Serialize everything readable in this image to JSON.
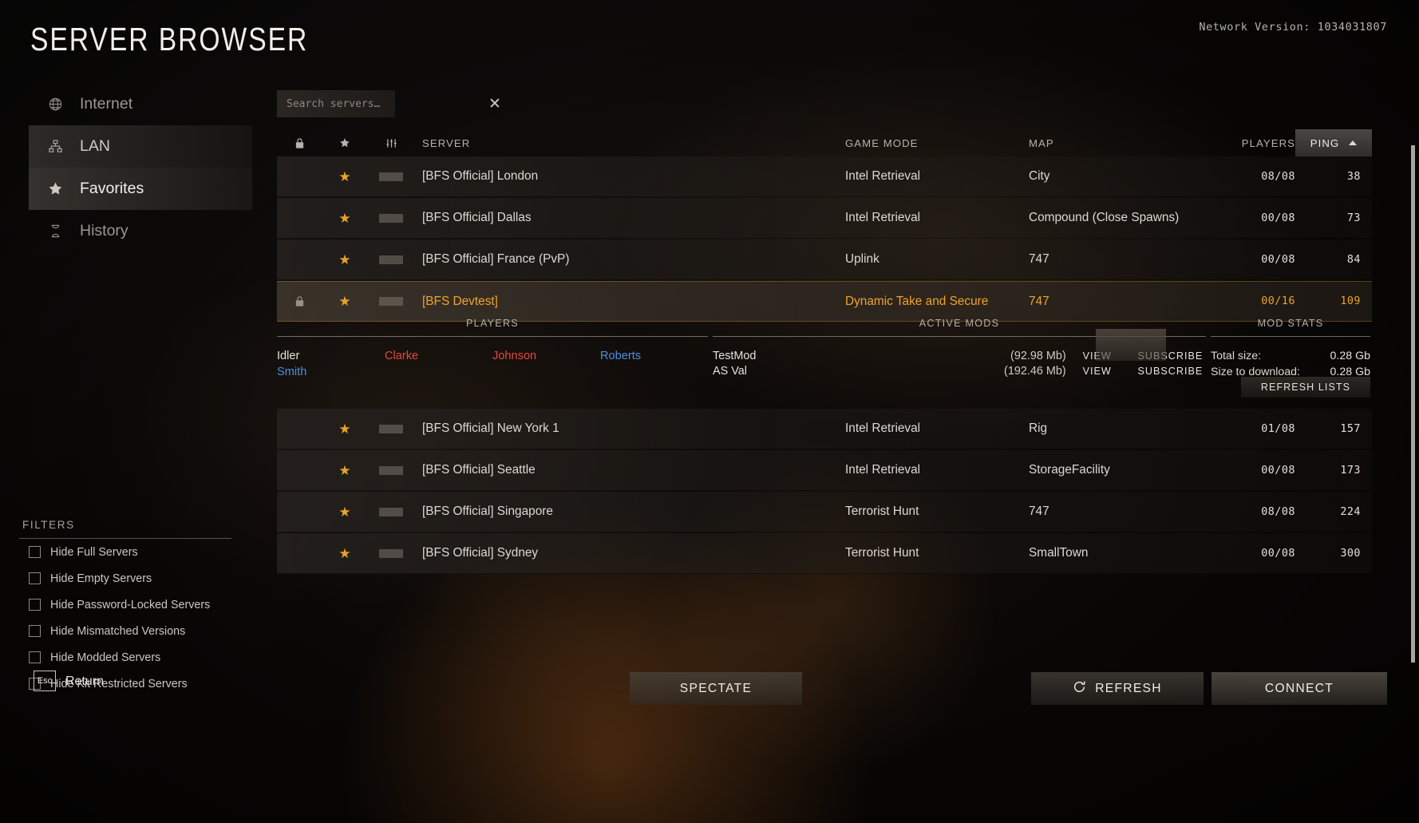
{
  "header": {
    "title": "Server Browser",
    "network_version": "Network Version: 1034031807"
  },
  "sidebar": {
    "items": [
      {
        "label": "Internet",
        "icon": "globe-icon",
        "state": "normal"
      },
      {
        "label": "LAN",
        "icon": "network-icon",
        "state": "hover"
      },
      {
        "label": "Favorites",
        "icon": "star-icon",
        "state": "active"
      },
      {
        "label": "History",
        "icon": "hourglass-icon",
        "state": "normal"
      }
    ]
  },
  "filters": {
    "title": "FILTERS",
    "items": [
      {
        "label": "Hide Full Servers",
        "checked": false
      },
      {
        "label": "Hide Empty Servers",
        "checked": false
      },
      {
        "label": "Hide Password-Locked Servers",
        "checked": false
      },
      {
        "label": "Hide Mismatched Versions",
        "checked": false
      },
      {
        "label": "Hide Modded Servers",
        "checked": false
      },
      {
        "label": "Hide Kit Restricted Servers",
        "checked": false
      }
    ]
  },
  "search": {
    "value": "",
    "placeholder": "Search servers…",
    "clear_icon": "close-icon"
  },
  "table": {
    "headers": {
      "lock": "lock-icon",
      "favorite": "star-icon",
      "mods": "sliders-icon",
      "server": "SERVER",
      "game_mode": "GAME MODE",
      "map": "MAP",
      "players": "PLAYERS",
      "ping": "PING",
      "sort_direction": "ascending"
    },
    "rows": [
      {
        "locked": false,
        "favorite": true,
        "modded": true,
        "name": "[BFS Official] London",
        "mode": "Intel Retrieval",
        "map": "City",
        "players": "08/08",
        "ping": "38",
        "selected": false
      },
      {
        "locked": false,
        "favorite": true,
        "modded": true,
        "name": "[BFS Official] Dallas",
        "mode": "Intel Retrieval",
        "map": "Compound (Close Spawns)",
        "players": "00/08",
        "ping": "73",
        "selected": false
      },
      {
        "locked": false,
        "favorite": true,
        "modded": true,
        "name": "[BFS Official] France (PvP)",
        "mode": "Uplink",
        "map": "747",
        "players": "00/08",
        "ping": "84",
        "selected": false
      },
      {
        "locked": true,
        "favorite": true,
        "modded": true,
        "name": "[BFS Devtest]",
        "mode": "Dynamic Take and Secure",
        "map": "747",
        "players": "00/16",
        "ping": "109",
        "selected": true
      },
      {
        "locked": false,
        "favorite": true,
        "modded": true,
        "name": "[BFS Official] New York 1",
        "mode": "Intel Retrieval",
        "map": "Rig",
        "players": "01/08",
        "ping": "157",
        "selected": false
      },
      {
        "locked": false,
        "favorite": true,
        "modded": true,
        "name": "[BFS Official] Seattle",
        "mode": "Intel Retrieval",
        "map": "StorageFacility",
        "players": "00/08",
        "ping": "173",
        "selected": false
      },
      {
        "locked": false,
        "favorite": true,
        "modded": true,
        "name": "[BFS Official] Singapore",
        "mode": "Terrorist Hunt",
        "map": "747",
        "players": "08/08",
        "ping": "224",
        "selected": false
      },
      {
        "locked": false,
        "favorite": true,
        "modded": true,
        "name": "[BFS Official] Sydney",
        "mode": "Terrorist Hunt",
        "map": "SmallTown",
        "players": "00/08",
        "ping": "300",
        "selected": false
      }
    ]
  },
  "detail": {
    "players_title": "PLAYERS",
    "mods_title": "ACTIVE MODS",
    "stats_title": "MOD STATS",
    "players": [
      {
        "name": "Idler",
        "team": "white"
      },
      {
        "name": "Clarke",
        "team": "red"
      },
      {
        "name": "Johnson",
        "team": "red"
      },
      {
        "name": "Roberts",
        "team": "blue"
      },
      {
        "name": "Smith",
        "team": "blue"
      }
    ],
    "mods": [
      {
        "name": "TestMod",
        "size": "(92.98 Mb)",
        "view": "VIEW",
        "subscribe": "SUBSCRIBE"
      },
      {
        "name": "AS Val",
        "size": "(192.46 Mb)",
        "view": "VIEW",
        "subscribe": "SUBSCRIBE"
      }
    ],
    "stats": [
      {
        "key": "Total size:",
        "value": "0.28 Gb"
      },
      {
        "key": "Size to download:",
        "value": "0.28 Gb"
      }
    ],
    "refresh_lists": "REFRESH LISTS"
  },
  "footer": {
    "esc_key": "Esc",
    "esc_label": "Return",
    "spectate": "SPECTATE",
    "refresh": "REFRESH",
    "refresh_icon": "refresh-icon",
    "connect": "CONNECT"
  },
  "colors": {
    "accent": "#f0a22c",
    "team_red": "#e3483d",
    "team_blue": "#4d8fe0",
    "text": "#ddd9d3"
  }
}
